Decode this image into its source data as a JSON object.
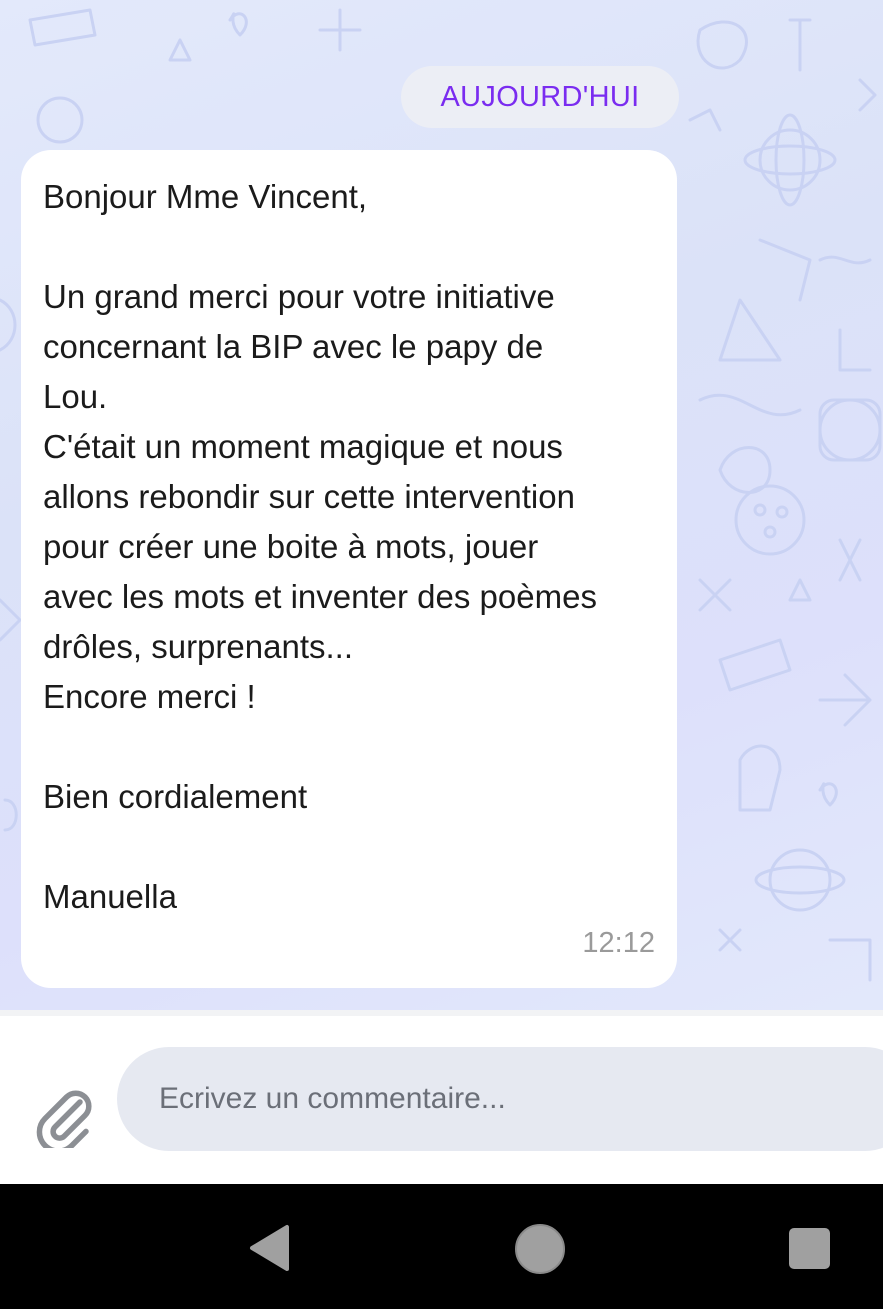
{
  "date_label": "AUJOURD'HUI",
  "message": {
    "lines": [
      "Bonjour Mme Vincent,",
      "",
      "Un grand merci pour votre initiative",
      "concernant la BIP avec le papy de",
      "Lou.",
      "C'était un moment magique et nous",
      "allons rebondir sur cette intervention",
      "pour créer une boite à mots, jouer",
      "avec les mots et inventer des poèmes",
      "drôles, surprenants...",
      "Encore merci !",
      "",
      "Bien cordialement",
      "",
      "Manuella"
    ],
    "time": "12:12"
  },
  "composer": {
    "placeholder": "Ecrivez un commentaire...",
    "attach_icon": "paperclip-icon"
  },
  "navbar": {
    "back_icon": "back-triangle-icon",
    "home_icon": "home-circle-icon",
    "recent_icon": "recent-apps-square-icon"
  },
  "colors": {
    "chat_background": "#dfe5fa",
    "date_text": "#7a2cf0",
    "bubble": "#ffffff",
    "input_background": "#e6e9f1",
    "navbar": "#000000"
  }
}
